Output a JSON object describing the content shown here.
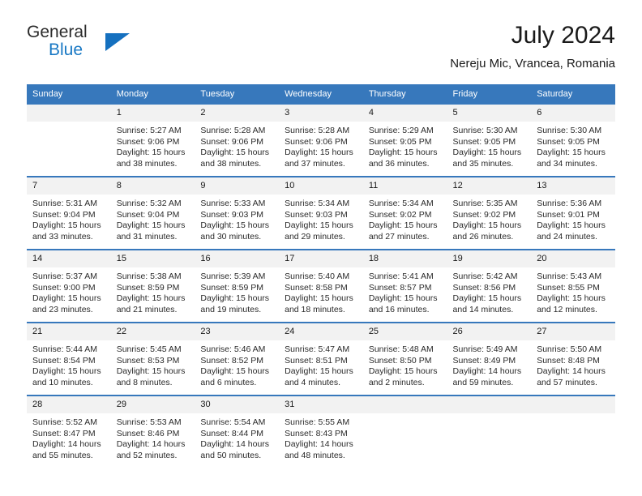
{
  "brand": {
    "name_part1": "General",
    "name_part2": "Blue",
    "logo_icon": "triangle-icon"
  },
  "header": {
    "title": "July 2024",
    "subtitle": "Nereju Mic, Vrancea, Romania"
  },
  "calendar": {
    "accent_color": "#3778bc",
    "daynum_bg": "#f2f2f2",
    "weekday_headers": [
      "Sunday",
      "Monday",
      "Tuesday",
      "Wednesday",
      "Thursday",
      "Friday",
      "Saturday"
    ],
    "weeks": [
      [
        {
          "day": "",
          "sunrise": "",
          "sunset": "",
          "daylight": "",
          "empty": true
        },
        {
          "day": "1",
          "sunrise": "Sunrise: 5:27 AM",
          "sunset": "Sunset: 9:06 PM",
          "daylight": "Daylight: 15 hours and 38 minutes."
        },
        {
          "day": "2",
          "sunrise": "Sunrise: 5:28 AM",
          "sunset": "Sunset: 9:06 PM",
          "daylight": "Daylight: 15 hours and 38 minutes."
        },
        {
          "day": "3",
          "sunrise": "Sunrise: 5:28 AM",
          "sunset": "Sunset: 9:06 PM",
          "daylight": "Daylight: 15 hours and 37 minutes."
        },
        {
          "day": "4",
          "sunrise": "Sunrise: 5:29 AM",
          "sunset": "Sunset: 9:05 PM",
          "daylight": "Daylight: 15 hours and 36 minutes."
        },
        {
          "day": "5",
          "sunrise": "Sunrise: 5:30 AM",
          "sunset": "Sunset: 9:05 PM",
          "daylight": "Daylight: 15 hours and 35 minutes."
        },
        {
          "day": "6",
          "sunrise": "Sunrise: 5:30 AM",
          "sunset": "Sunset: 9:05 PM",
          "daylight": "Daylight: 15 hours and 34 minutes."
        }
      ],
      [
        {
          "day": "7",
          "sunrise": "Sunrise: 5:31 AM",
          "sunset": "Sunset: 9:04 PM",
          "daylight": "Daylight: 15 hours and 33 minutes."
        },
        {
          "day": "8",
          "sunrise": "Sunrise: 5:32 AM",
          "sunset": "Sunset: 9:04 PM",
          "daylight": "Daylight: 15 hours and 31 minutes."
        },
        {
          "day": "9",
          "sunrise": "Sunrise: 5:33 AM",
          "sunset": "Sunset: 9:03 PM",
          "daylight": "Daylight: 15 hours and 30 minutes."
        },
        {
          "day": "10",
          "sunrise": "Sunrise: 5:34 AM",
          "sunset": "Sunset: 9:03 PM",
          "daylight": "Daylight: 15 hours and 29 minutes."
        },
        {
          "day": "11",
          "sunrise": "Sunrise: 5:34 AM",
          "sunset": "Sunset: 9:02 PM",
          "daylight": "Daylight: 15 hours and 27 minutes."
        },
        {
          "day": "12",
          "sunrise": "Sunrise: 5:35 AM",
          "sunset": "Sunset: 9:02 PM",
          "daylight": "Daylight: 15 hours and 26 minutes."
        },
        {
          "day": "13",
          "sunrise": "Sunrise: 5:36 AM",
          "sunset": "Sunset: 9:01 PM",
          "daylight": "Daylight: 15 hours and 24 minutes."
        }
      ],
      [
        {
          "day": "14",
          "sunrise": "Sunrise: 5:37 AM",
          "sunset": "Sunset: 9:00 PM",
          "daylight": "Daylight: 15 hours and 23 minutes."
        },
        {
          "day": "15",
          "sunrise": "Sunrise: 5:38 AM",
          "sunset": "Sunset: 8:59 PM",
          "daylight": "Daylight: 15 hours and 21 minutes."
        },
        {
          "day": "16",
          "sunrise": "Sunrise: 5:39 AM",
          "sunset": "Sunset: 8:59 PM",
          "daylight": "Daylight: 15 hours and 19 minutes."
        },
        {
          "day": "17",
          "sunrise": "Sunrise: 5:40 AM",
          "sunset": "Sunset: 8:58 PM",
          "daylight": "Daylight: 15 hours and 18 minutes."
        },
        {
          "day": "18",
          "sunrise": "Sunrise: 5:41 AM",
          "sunset": "Sunset: 8:57 PM",
          "daylight": "Daylight: 15 hours and 16 minutes."
        },
        {
          "day": "19",
          "sunrise": "Sunrise: 5:42 AM",
          "sunset": "Sunset: 8:56 PM",
          "daylight": "Daylight: 15 hours and 14 minutes."
        },
        {
          "day": "20",
          "sunrise": "Sunrise: 5:43 AM",
          "sunset": "Sunset: 8:55 PM",
          "daylight": "Daylight: 15 hours and 12 minutes."
        }
      ],
      [
        {
          "day": "21",
          "sunrise": "Sunrise: 5:44 AM",
          "sunset": "Sunset: 8:54 PM",
          "daylight": "Daylight: 15 hours and 10 minutes."
        },
        {
          "day": "22",
          "sunrise": "Sunrise: 5:45 AM",
          "sunset": "Sunset: 8:53 PM",
          "daylight": "Daylight: 15 hours and 8 minutes."
        },
        {
          "day": "23",
          "sunrise": "Sunrise: 5:46 AM",
          "sunset": "Sunset: 8:52 PM",
          "daylight": "Daylight: 15 hours and 6 minutes."
        },
        {
          "day": "24",
          "sunrise": "Sunrise: 5:47 AM",
          "sunset": "Sunset: 8:51 PM",
          "daylight": "Daylight: 15 hours and 4 minutes."
        },
        {
          "day": "25",
          "sunrise": "Sunrise: 5:48 AM",
          "sunset": "Sunset: 8:50 PM",
          "daylight": "Daylight: 15 hours and 2 minutes."
        },
        {
          "day": "26",
          "sunrise": "Sunrise: 5:49 AM",
          "sunset": "Sunset: 8:49 PM",
          "daylight": "Daylight: 14 hours and 59 minutes."
        },
        {
          "day": "27",
          "sunrise": "Sunrise: 5:50 AM",
          "sunset": "Sunset: 8:48 PM",
          "daylight": "Daylight: 14 hours and 57 minutes."
        }
      ],
      [
        {
          "day": "28",
          "sunrise": "Sunrise: 5:52 AM",
          "sunset": "Sunset: 8:47 PM",
          "daylight": "Daylight: 14 hours and 55 minutes."
        },
        {
          "day": "29",
          "sunrise": "Sunrise: 5:53 AM",
          "sunset": "Sunset: 8:46 PM",
          "daylight": "Daylight: 14 hours and 52 minutes."
        },
        {
          "day": "30",
          "sunrise": "Sunrise: 5:54 AM",
          "sunset": "Sunset: 8:44 PM",
          "daylight": "Daylight: 14 hours and 50 minutes."
        },
        {
          "day": "31",
          "sunrise": "Sunrise: 5:55 AM",
          "sunset": "Sunset: 8:43 PM",
          "daylight": "Daylight: 14 hours and 48 minutes."
        },
        {
          "day": "",
          "sunrise": "",
          "sunset": "",
          "daylight": "",
          "empty": true
        },
        {
          "day": "",
          "sunrise": "",
          "sunset": "",
          "daylight": "",
          "empty": true
        },
        {
          "day": "",
          "sunrise": "",
          "sunset": "",
          "daylight": "",
          "empty": true
        }
      ]
    ]
  }
}
